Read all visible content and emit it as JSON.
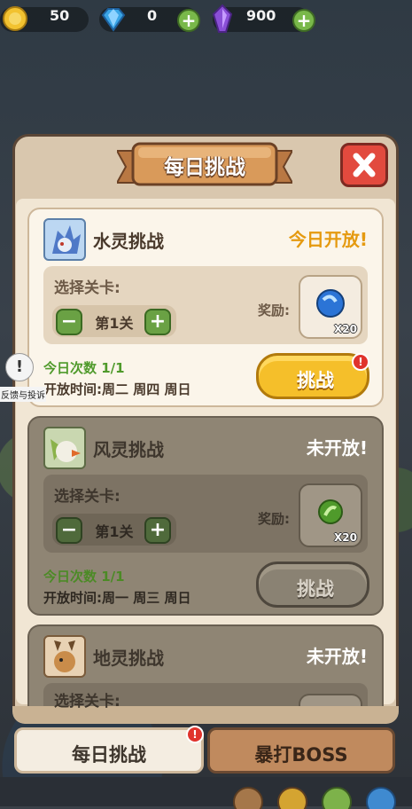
{
  "currency": {
    "gold": "50",
    "diamond": "0",
    "gem": "900"
  },
  "popup": {
    "title": "每日挑战",
    "close_icon": "close-x-icon"
  },
  "challenges": [
    {
      "title": "水灵挑战",
      "status": "今日开放!",
      "select_label": "选择关卡:",
      "stage": "第1关",
      "reward_label": "奖励:",
      "reward_count": "X20",
      "times": "今日次数 1/1",
      "open_time": "开放时间:周二 周四 周日",
      "button": "挑战",
      "badge": "!"
    },
    {
      "title": "风灵挑战",
      "status": "未开放!",
      "select_label": "选择关卡:",
      "stage": "第1关",
      "reward_label": "奖励:",
      "reward_count": "X20",
      "times": "今日次数 1/1",
      "open_time": "开放时间:周一 周三 周日",
      "button": "挑战"
    },
    {
      "title": "地灵挑战",
      "status": "未开放!",
      "select_label": "选择关卡:"
    }
  ],
  "feedback": {
    "icon": "!",
    "label": "反馈与投诉"
  },
  "tabs": {
    "daily": "每日挑战",
    "boss": "暴打BOSS",
    "badge": "!"
  },
  "colors": {
    "accent_gold": "#f0b42a",
    "status_open": "#e59a10",
    "status_closed": "#ffffff",
    "times_green": "#4f9a2b",
    "close_red": "#e24a3e"
  }
}
